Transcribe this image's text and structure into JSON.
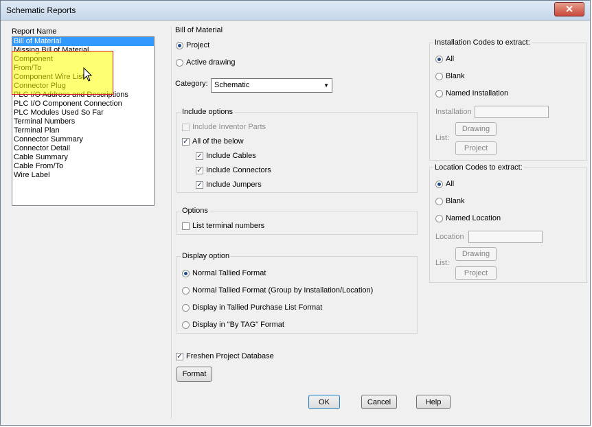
{
  "window": {
    "title": "Schematic Reports",
    "close_glyph": "✕"
  },
  "report_list": {
    "label": "Report Name",
    "items": [
      "Bill of Material",
      "Missing Bill of Material",
      "Component",
      "From/To",
      "Component Wire List",
      "Connector Plug",
      "PLC I/O Address and Descriptions",
      "PLC I/O Component Connection",
      "PLC Modules Used So Far",
      "Terminal Numbers",
      "Terminal Plan",
      "Connector Summary",
      "Connector Detail",
      "Cable Summary",
      "Cable From/To",
      "Wire Label"
    ],
    "selected": "Bill of Material"
  },
  "bom": {
    "title": "Bill of Material",
    "project": "Project",
    "active_drawing": "Active drawing",
    "category_label": "Category:",
    "category_value": "Schematic"
  },
  "include_options": {
    "title": "Include options",
    "inventor": "Include Inventor Parts",
    "all_below": "All of the below",
    "cables": "Include Cables",
    "connectors": "Include Connectors",
    "jumpers": "Include Jumpers"
  },
  "options": {
    "title": "Options",
    "terminal_numbers": "List terminal numbers"
  },
  "display_option": {
    "title": "Display option",
    "normal": "Normal Tallied Format",
    "grouped": "Normal Tallied Format (Group by Installation/Location)",
    "purchase": "Display in Tallied Purchase List Format",
    "by_tag": "Display in \"By TAG\" Format"
  },
  "installation": {
    "title": "Installation Codes to extract:",
    "all": "All",
    "blank": "Blank",
    "named": "Named Installation",
    "field_label": "Installation",
    "list_label": "List:",
    "drawing_btn": "Drawing",
    "project_btn": "Project"
  },
  "location": {
    "title": "Location Codes to extract:",
    "all": "All",
    "blank": "Blank",
    "named": "Named Location",
    "field_label": "Location",
    "list_label": "List:",
    "drawing_btn": "Drawing",
    "project_btn": "Project"
  },
  "freshen": "Freshen Project Database",
  "buttons": {
    "format": "Format",
    "ok": "OK",
    "cancel": "Cancel",
    "help": "Help"
  }
}
